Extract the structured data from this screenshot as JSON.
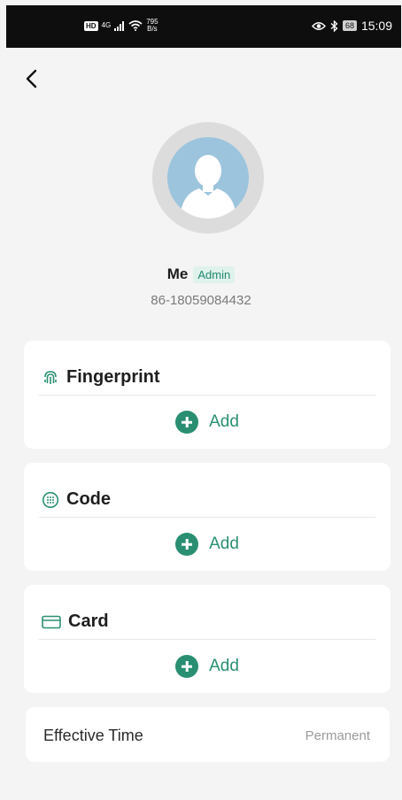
{
  "status_bar": {
    "hd": "HD",
    "network": "4G",
    "speed_value": "795",
    "speed_unit": "B/s",
    "battery": "68",
    "time": "15:09"
  },
  "profile": {
    "name": "Me",
    "role": "Admin",
    "phone": "86-18059084432"
  },
  "methods": [
    {
      "title": "Fingerprint",
      "icon": "fingerprint-icon",
      "add_label": "Add"
    },
    {
      "title": "Code",
      "icon": "keypad-icon",
      "add_label": "Add"
    },
    {
      "title": "Card",
      "icon": "card-icon",
      "add_label": "Add"
    }
  ],
  "effective_time": {
    "label": "Effective Time",
    "value": "Permanent"
  },
  "colors": {
    "accent": "#2a8f72",
    "badge_bg": "#dff2ec",
    "avatar_bg": "#9cc4dd",
    "page_bg": "#f4f4f4"
  }
}
